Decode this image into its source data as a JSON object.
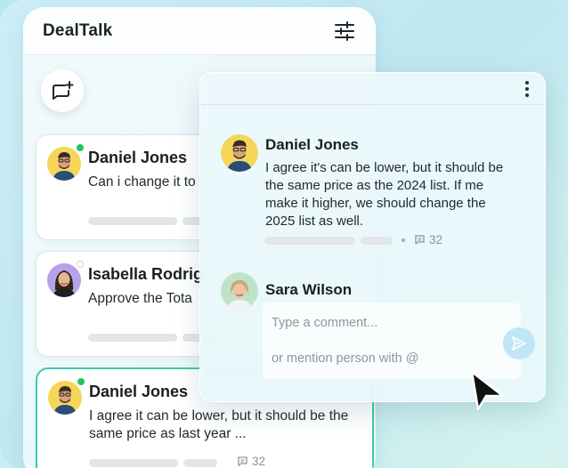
{
  "app": {
    "title": "DealTalk"
  },
  "conversations": [
    {
      "name": "Daniel Jones",
      "message": "Can i change it to",
      "status": "online",
      "avatar": "daniel-avatar"
    },
    {
      "name": "Isabella Rodrig",
      "message": "Approve the Tota",
      "status": "offline",
      "avatar": "isabella-avatar"
    },
    {
      "name": "Daniel Jones",
      "message": "I agree it can be lower, but it should be the same price as last year ...",
      "status": "online",
      "avatar": "daniel-avatar",
      "comment_count": "32",
      "active": true
    }
  ],
  "thread": {
    "comment": {
      "name": "Daniel Jones",
      "message": "I agree it's can be lower, but it should be the same price as the 2024 list. If me make it higher, we should change the 2025 list as well.",
      "comment_count": "32"
    },
    "reply": {
      "name": "Sara Wilson",
      "placeholder_line1": "Type a comment...",
      "placeholder_line2": "or mention person with @"
    }
  },
  "colors": {
    "accent_border": "#3cc9ad",
    "online": "#22c55e",
    "send_button": "#bfe6f7"
  }
}
